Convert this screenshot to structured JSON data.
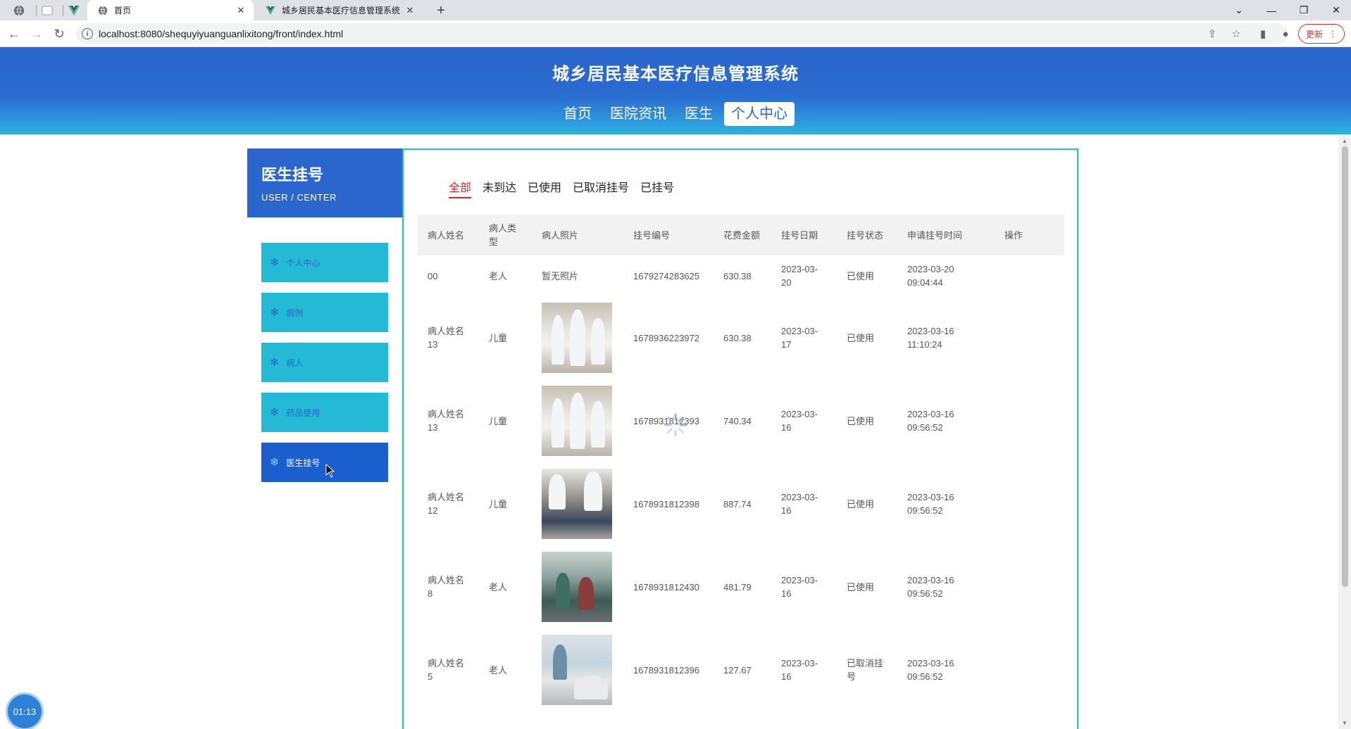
{
  "browser": {
    "tabs": [
      {
        "title": "首页",
        "active": true
      },
      {
        "title": "城乡居民基本医疗信息管理系统",
        "active": false
      }
    ],
    "url": "localhost:8080/shequyiyuanguanlixitong/front/index.html",
    "update_label": "更新"
  },
  "site": {
    "title": "城乡居民基本医疗信息管理系统",
    "nav": [
      "首页",
      "医院资讯",
      "医生",
      "个人中心"
    ],
    "active_nav": "个人中心"
  },
  "sidebar": {
    "title": "医生挂号",
    "subtitle": "USER / CENTER",
    "items": [
      {
        "label": "个人中心"
      },
      {
        "label": "病例"
      },
      {
        "label": "病人"
      },
      {
        "label": "药品使用"
      },
      {
        "label": "医生挂号"
      }
    ],
    "active_item": "医生挂号"
  },
  "filters": [
    "全部",
    "未到达",
    "已使用",
    "已取消挂号",
    "已挂号"
  ],
  "active_filter": "全部",
  "table": {
    "headers": [
      "病人姓名",
      "病人类型",
      "病人照片",
      "挂号编号",
      "花费金额",
      "挂号日期",
      "挂号状态",
      "申请挂号时间",
      "操作"
    ],
    "rows": [
      {
        "name": "00",
        "type": "老人",
        "photo_text": "暂无照片",
        "no": "1679274283625",
        "fee": "630.38",
        "date": "2023-03-20",
        "status": "已使用",
        "time": "2023-03-20 09:04:44"
      },
      {
        "name": "病人姓名13",
        "type": "儿童",
        "photo_text": "",
        "no": "1678936223972",
        "fee": "630.38",
        "date": "2023-03-17",
        "status": "已使用",
        "time": "2023-03-16 11:10:24"
      },
      {
        "name": "病人姓名13",
        "type": "儿童",
        "photo_text": "",
        "no": "1678931812393",
        "fee": "740.34",
        "date": "2023-03-16",
        "status": "已使用",
        "time": "2023-03-16 09:56:52"
      },
      {
        "name": "病人姓名12",
        "type": "儿童",
        "photo_text": "",
        "no": "1678931812398",
        "fee": "887.74",
        "date": "2023-03-16",
        "status": "已使用",
        "time": "2023-03-16 09:56:52"
      },
      {
        "name": "病人姓名8",
        "type": "老人",
        "photo_text": "",
        "no": "1678931812430",
        "fee": "481.79",
        "date": "2023-03-16",
        "status": "已使用",
        "time": "2023-03-16 09:56:52"
      },
      {
        "name": "病人姓名5",
        "type": "老人",
        "photo_text": "",
        "no": "1678931812396",
        "fee": "127.67",
        "date": "2023-03-16",
        "status": "已取消挂号",
        "time": "2023-03-16 09:56:52"
      }
    ]
  },
  "timer": "01:13",
  "icons": {
    "menu": "snowflake-icon",
    "loading": "spinner-icon"
  },
  "colors": {
    "primary": "#2a66cc",
    "accent": "#24bad6",
    "active_filter": "#d9232c"
  }
}
